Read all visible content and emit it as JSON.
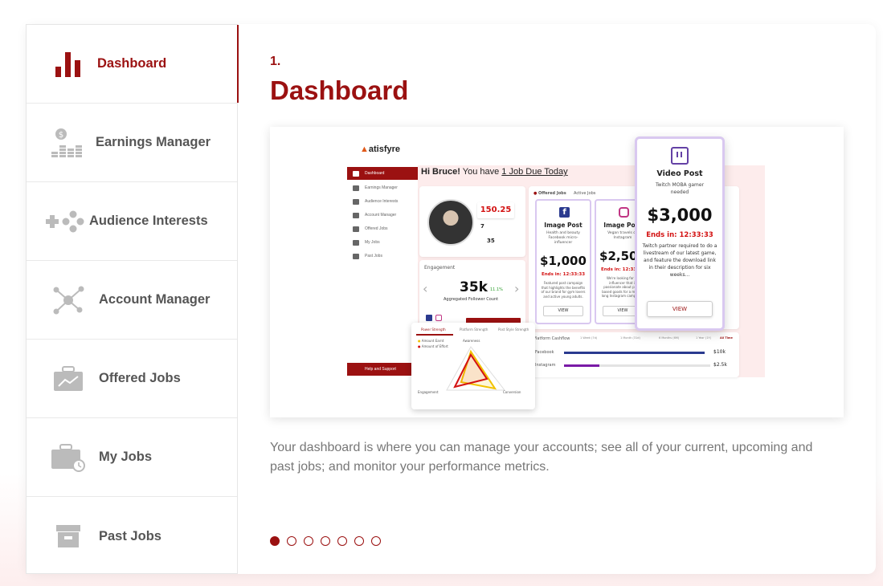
{
  "sidebar": {
    "items": [
      {
        "label": "Dashboard",
        "icon": "bar-chart-icon",
        "active": true
      },
      {
        "label": "Earnings Manager",
        "icon": "coins-icon",
        "active": false
      },
      {
        "label": "Audience Interests",
        "icon": "gamepad-icon",
        "active": false
      },
      {
        "label": "Account Manager",
        "icon": "network-icon",
        "active": false
      },
      {
        "label": "Offered Jobs",
        "icon": "briefcase-icon",
        "active": false
      },
      {
        "label": "My Jobs",
        "icon": "briefcase-clock-icon",
        "active": false
      },
      {
        "label": "Past Jobs",
        "icon": "archive-icon",
        "active": false
      }
    ]
  },
  "main": {
    "step_number": "1.",
    "title": "Dashboard",
    "description": "Your dashboard is where you can manage your accounts; see all of your current, upcoming and past jobs; and monitor your performance metrics.",
    "pagination": {
      "total": 7,
      "current": 1
    }
  },
  "preview": {
    "logo": "atisfyre",
    "greeting_name": "Hi Bruce!",
    "greeting_rest": " You have ",
    "greeting_link": "1 Job Due Today",
    "user_name": "Bruce",
    "nav": [
      "Dashboard",
      "Earnings Manager",
      "Audience Interests",
      "Account Manager",
      "Offered Jobs",
      "My Jobs",
      "Past Jobs"
    ],
    "help": "Help and Support",
    "score": "150.25",
    "score2": "7",
    "score3": "35",
    "engagement_label": "Engagement",
    "followers": "35k",
    "followers_pct": "11.1%",
    "followers_label": "Aggregated Follower Count",
    "jobs_tab": "Offered Jobs",
    "jobs_tab2": "Active Jobs",
    "job1": {
      "title": "Image Post",
      "sub": "Health and beauty Facebook micro-influencer",
      "amount": "$1,000",
      "ends": "Ends in: 12:33:33",
      "text": "Featured post campaign that highlights the benefits of our brand for gym lovers and active young adults.",
      "view": "VIEW"
    },
    "job2": {
      "title": "Image Post",
      "sub": "Vegan travels on Instagram",
      "amount": "$2,500",
      "ends": "Ends in: 12:33:33",
      "text": "We're looking for an influencer that is passionate about plant-based goods for a month-long Instagram campaign.",
      "view": "VIEW"
    },
    "video": {
      "title": "Video Post",
      "sub": "Twitch MOBA gamer needed",
      "amount": "$3,000",
      "ends": "Ends in: 12:33:33",
      "text": "Twitch partner required to do a livestream of our latest game, and feature the download link in their description for six weeks...",
      "view": "VIEW"
    },
    "radar": {
      "tab1": "Power Strength",
      "tab2": "Platform Strength",
      "tab3": "Post Style Strength",
      "legend1": "Amount Earnt",
      "legend2": "Amount of Effort",
      "axis_top": "Awareness",
      "axis_left": "Engagement",
      "axis_right": "Conversion"
    },
    "platforms": [
      {
        "name": "Facebook",
        "value": "$10k",
        "fraction": 0.96,
        "color": "#2a3a8f"
      },
      {
        "name": "Instagram",
        "value": "$2.5k",
        "fraction": 0.24,
        "color": "#7a1aa6"
      }
    ],
    "earnings_label": "Platform Cashflow",
    "range_tabs": [
      "1 Week (7d)",
      "1 Month (31d)",
      "6 Months (6M)",
      "1 Year (1Y)",
      "All Time"
    ]
  }
}
